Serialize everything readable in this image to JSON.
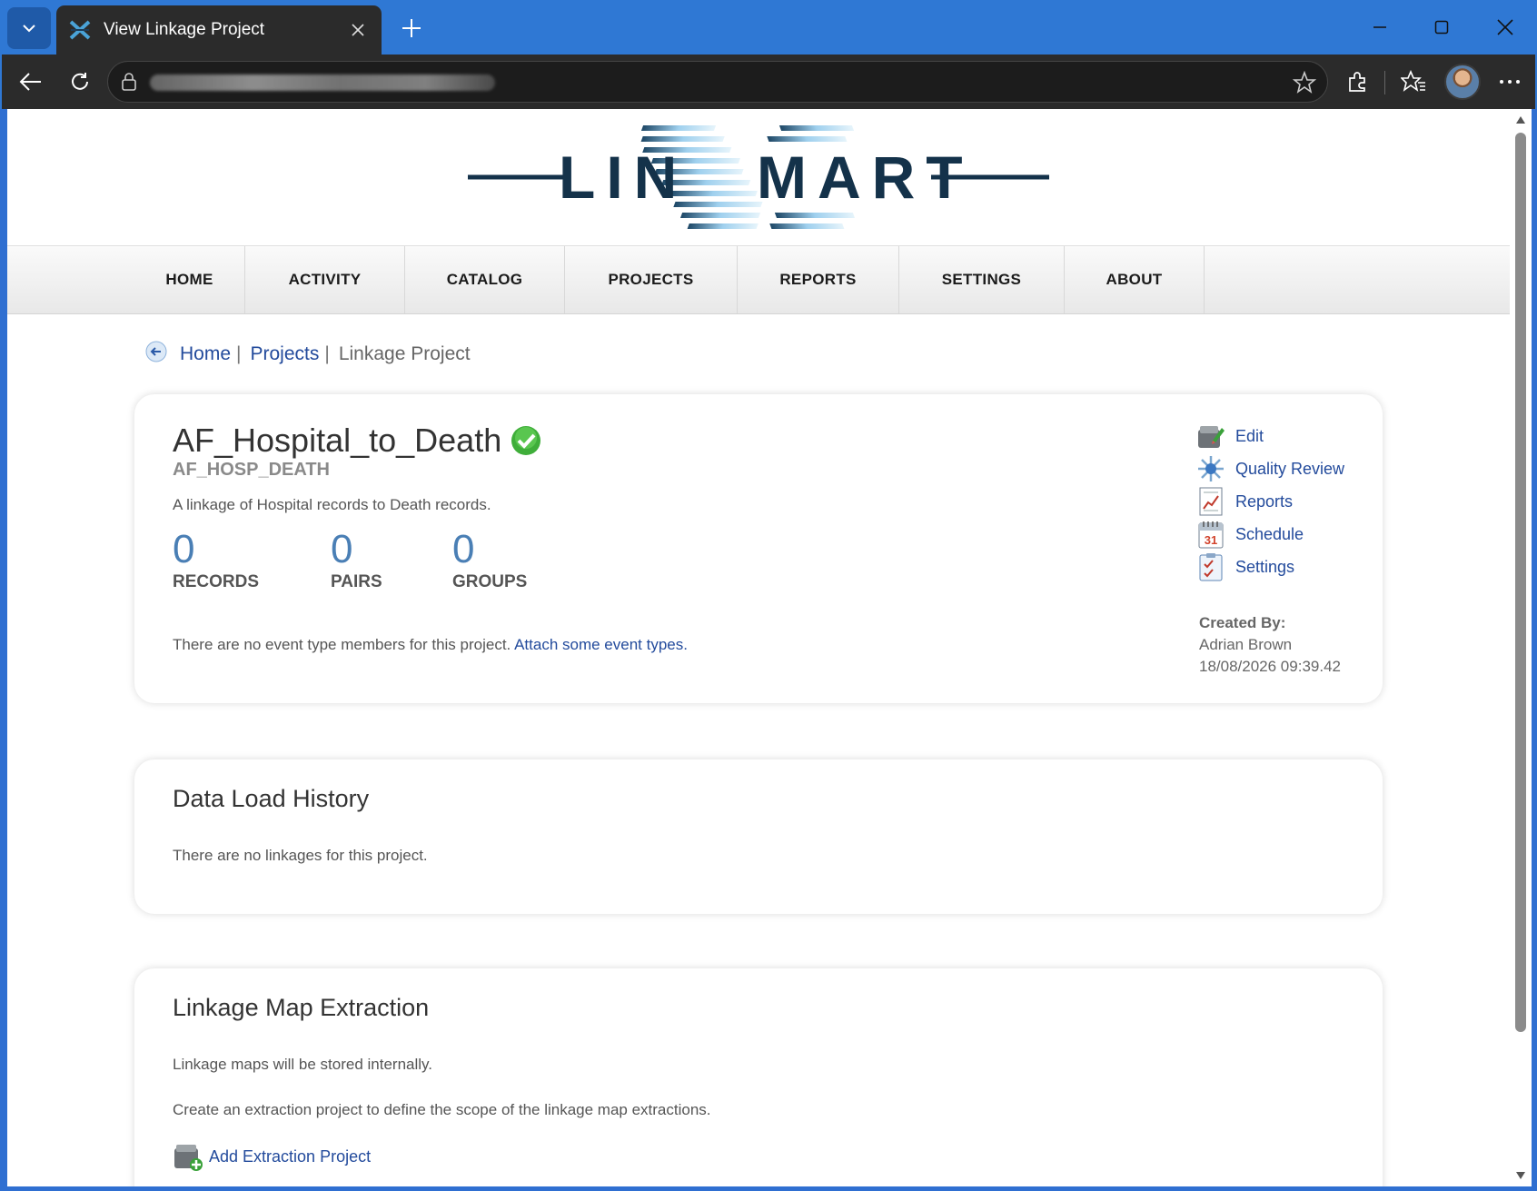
{
  "browser": {
    "tab_title": "View Linkage Project"
  },
  "site": {
    "logo_text_left": "LIN",
    "logo_text_right": "MART",
    "nav": [
      "HOME",
      "ACTIVITY",
      "CATALOG",
      "PROJECTS",
      "REPORTS",
      "SETTINGS",
      "ABOUT"
    ]
  },
  "breadcrumb": {
    "home": "Home",
    "projects": "Projects",
    "current": "Linkage Project",
    "sep": "|"
  },
  "project": {
    "name": "AF_Hospital_to_Death",
    "code": "AF_HOSP_DEATH",
    "description": "A linkage of Hospital records to Death records.",
    "stats": [
      {
        "value": "0",
        "label": "RECORDS"
      },
      {
        "value": "0",
        "label": "PAIRS"
      },
      {
        "value": "0",
        "label": "GROUPS"
      }
    ],
    "event_note": "There are no event type members for this project.",
    "event_link": "Attach some event types.",
    "actions": [
      "Edit",
      "Quality Review",
      "Reports",
      "Schedule",
      "Settings"
    ],
    "created_label": "Created By:",
    "created_by": "Adrian Brown",
    "created_at": "18/08/2026 09:39.42"
  },
  "history": {
    "title": "Data Load History",
    "text": "There are no linkages for this project."
  },
  "extraction": {
    "title": "Linkage Map Extraction",
    "text1": "Linkage maps will be stored internally.",
    "text2": "Create an extraction project to define the scope of the linkage map extractions.",
    "add_label": "Add Extraction Project"
  },
  "colors": {
    "accent": "#234b9c",
    "stat": "#4a7fb5",
    "title_bar": "#2f78d4"
  }
}
